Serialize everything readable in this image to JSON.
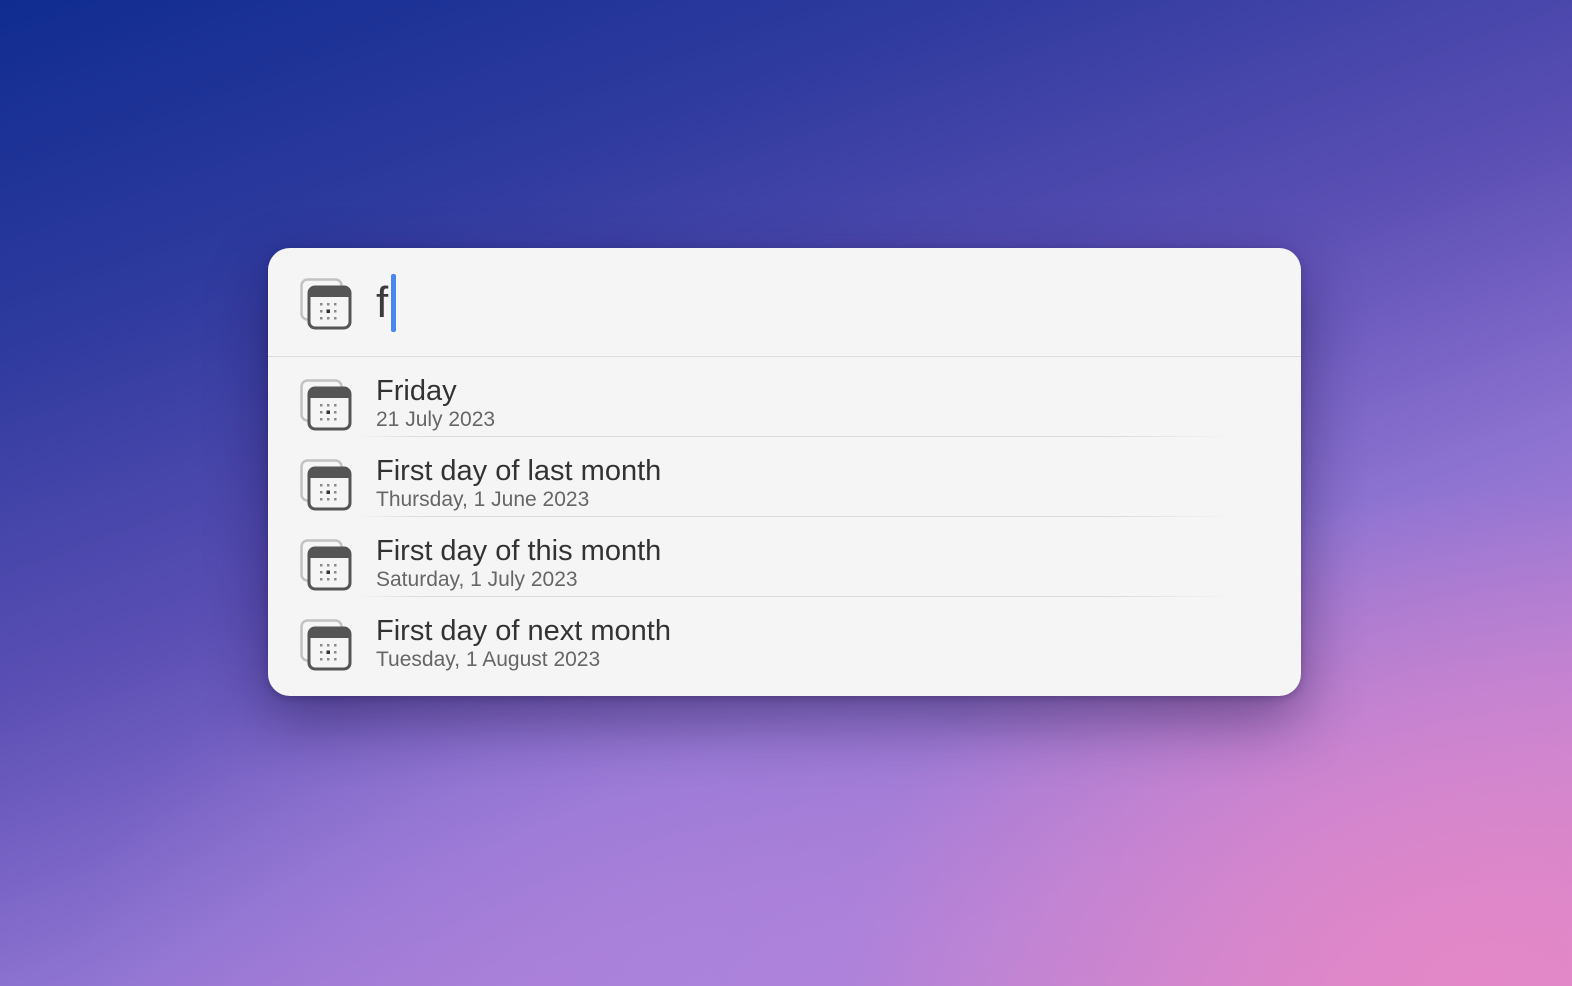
{
  "search": {
    "query": "f",
    "icon": "calendar-icon"
  },
  "results": [
    {
      "title": "Friday",
      "subtitle": "21 July 2023",
      "icon": "calendar-icon"
    },
    {
      "title": "First day of last month",
      "subtitle": "Thursday, 1 June 2023",
      "icon": "calendar-icon"
    },
    {
      "title": "First day of this month",
      "subtitle": "Saturday, 1 July 2023",
      "icon": "calendar-icon"
    },
    {
      "title": "First day of next month",
      "subtitle": "Tuesday, 1 August 2023",
      "icon": "calendar-icon"
    }
  ],
  "colors": {
    "caret": "#4a86f0",
    "panel": "#f5f5f5",
    "icon": "#555555"
  }
}
